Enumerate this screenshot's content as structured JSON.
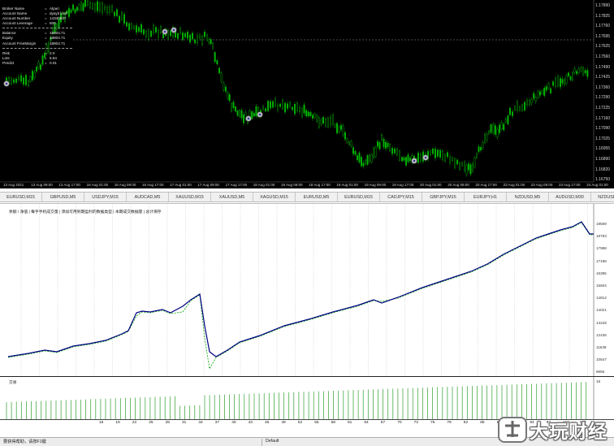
{
  "account": {
    "rows": [
      {
        "label": "Broker Name",
        "value": "Alpari"
      },
      {
        "label": "Account Name",
        "value": "dyayti krwf"
      },
      {
        "label": "Account Number",
        "value": "14340837"
      },
      {
        "label": "Account Leverage",
        "value": "500"
      }
    ],
    "money_rows": [
      {
        "label": "Balance",
        "value": "18804.71"
      },
      {
        "label": "Equity",
        "value": "18804.71"
      },
      {
        "label": "Account FreeMargin",
        "value": "18804.71"
      }
    ],
    "risk_rows": [
      {
        "label": "Risk",
        "value": "2.0"
      },
      {
        "label": "Lots",
        "value": "5.64"
      },
      {
        "label": "Predict",
        "value": "0.01"
      }
    ],
    "separator": "="
  },
  "price_axis": [
    "1.17890",
    "1.17825",
    "1.17760",
    "1.17695",
    "1.17625",
    "1.17560",
    "1.17490",
    "1.17425",
    "1.17360",
    "1.17290",
    "1.17225",
    "1.17160",
    "1.17090",
    "1.17025",
    "1.16955",
    "1.16890",
    "1.16820",
    "1.16750"
  ],
  "date_axis": [
    "13 Aug 2021",
    "13 Aug 09:00",
    "13 Aug 17:00",
    "16 Aug 01:00",
    "16 Aug 09:00",
    "16 Aug 17:00",
    "17 Aug 01:00",
    "17 Aug 09:00",
    "17 Aug 17:00",
    "18 Aug 01:00",
    "18 Aug 09:00",
    "18 Aug 17:00",
    "19 Aug 01:00",
    "19 Aug 09:00",
    "19 Aug 17:00",
    "20 Aug 01:00",
    "20 Aug 09:00",
    "20 Aug 17:00",
    "23 Aug 01:00",
    "23 Aug 09:00",
    "23 Aug 17:00",
    "24 Aug 01:00"
  ],
  "symbol_tabs": [
    "EURUSD,M15",
    "GBPUSD,M5",
    "USDJPY,M15",
    "AUDCAD,M5",
    "XAUUSD,M15",
    "XAUUSD,M5",
    "XAGUSD,M15",
    "EURUSD,M5",
    "EURUSD,M15",
    "CADJPY,M15",
    "GBPJPY,M15",
    "EURJPY,H1",
    "NZDUSD,M5",
    "AUDUSD,M30",
    "NZDUSD,M15",
    "E"
  ],
  "equity": {
    "legend": "余额 / 净值 | 每手手机成交量 | 添加可用到期盈利的数据类型 | 本期成交数据量 | 总计保存",
    "axis": [
      "19569",
      "18783",
      "17988",
      "17188",
      "16395",
      "15604",
      "14812",
      "14021",
      "13228",
      "12436",
      "11638",
      "10847",
      "9656",
      "9665"
    ]
  },
  "volume": {
    "label": "交易",
    "max_label": "18"
  },
  "trade_axis": [
    "16",
    "19",
    "22",
    "25",
    "28",
    "31",
    "34",
    "37",
    "40",
    "43",
    "46",
    "49",
    "52",
    "55",
    "58",
    "61",
    "64",
    "67",
    "70",
    "73",
    "76",
    "79",
    "82",
    "85",
    "88",
    "91",
    "94",
    "97",
    "100",
    "103"
  ],
  "status": {
    "left": "要获得帮助，请按F1键",
    "mid": "Default"
  },
  "watermark": {
    "text": "大玩财经"
  },
  "colors": {
    "bull_candle": "#00c000",
    "bear_candle": "#00c000",
    "balance_line": "#000080",
    "equity_line": "#00a000",
    "volume_bar": "#2e9e2e"
  }
}
